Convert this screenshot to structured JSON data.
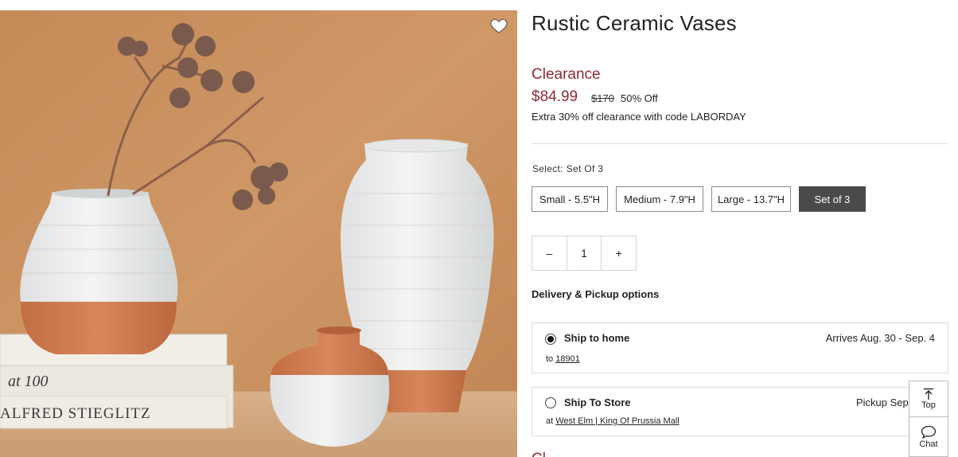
{
  "product": {
    "title": "Rustic Ceramic Vases",
    "badge": "Clearance",
    "price": "$84.99",
    "was_price": "$170",
    "discount": "50% Off",
    "promo": "Extra 30% off clearance with code LABORDAY"
  },
  "image": {
    "book_top_title": "at 100",
    "book_bottom_title": "ALFRED STIEGLITZ",
    "favorite_icon": "heart-icon"
  },
  "select": {
    "label": "Select:",
    "value": "Set Of 3",
    "options": [
      "Small - 5.5\"H",
      "Medium - 7.9\"H",
      "Large - 13.7\"H",
      "Set of 3"
    ],
    "selected_index": 3
  },
  "quantity": {
    "minus": "–",
    "value": "1",
    "plus": "+"
  },
  "delivery": {
    "heading": "Delivery & Pickup options",
    "ship_home": {
      "label": "Ship to home",
      "eta": "Arrives Aug. 30 - Sep. 4",
      "to_prefix": "to",
      "zip": "18901",
      "selected": true
    },
    "ship_store": {
      "label": "Ship To Store",
      "eta": "Pickup Sep",
      "at_prefix": "at",
      "store": "West Elm | King Of Prussia Mall",
      "selected": false
    }
  },
  "cut_off_text": "Cl",
  "floating": {
    "top_label": "Top",
    "chat_label": "Chat"
  },
  "colors": {
    "clearance": "#8e2a35",
    "selected_option_bg": "#4a4a4a",
    "wood_wall": "#c98f5a",
    "terracotta": "#c9774b"
  }
}
